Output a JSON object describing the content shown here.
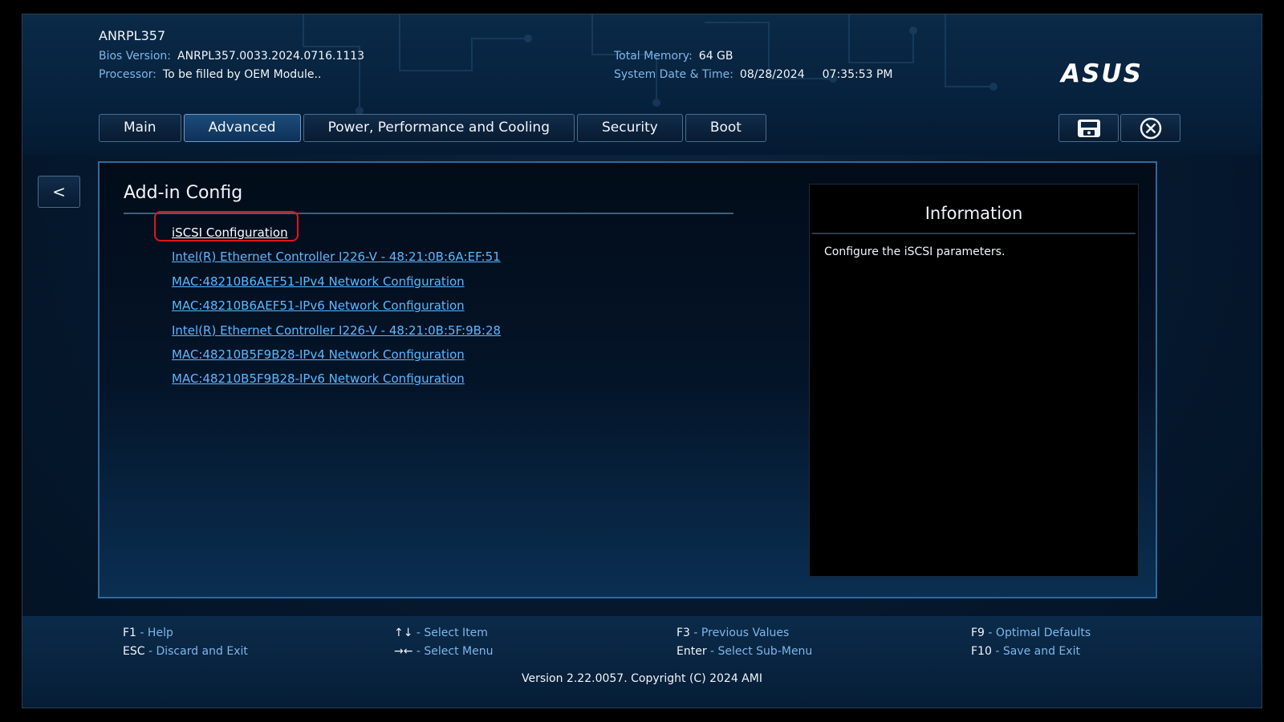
{
  "system": {
    "model": "ANRPL357",
    "bios_label": "Bios Version:",
    "bios_value": "ANRPL357.0033.2024.0716.1113",
    "processor_label": "Processor:",
    "processor_value": "To be filled by OEM Module..",
    "memory_label": "Total Memory:",
    "memory_value": "64 GB",
    "datetime_label": "System Date & Time:",
    "date_value": "08/28/2024",
    "time_value": "07:35:53 PM"
  },
  "brand": {
    "logo": "ASUS",
    "accent": "#5ab8ff",
    "highlight": "#e1151c"
  },
  "tabs": [
    {
      "label": "Main"
    },
    {
      "label": "Advanced",
      "active": true
    },
    {
      "label": "Power, Performance and Cooling"
    },
    {
      "label": "Security"
    },
    {
      "label": "Boot"
    }
  ],
  "toolbar": {
    "save_icon": "floppy-disk-icon",
    "exit_icon": "close-circle-icon"
  },
  "nav": {
    "back_label": "<"
  },
  "page": {
    "title": "Add-in Config",
    "items": [
      {
        "label": "iSCSI Configuration",
        "selected": true
      },
      {
        "label": "Intel(R) Ethernet Controller I226-V - 48:21:0B:6A:EF:51"
      },
      {
        "label": "MAC:48210B6AEF51-IPv4 Network Configuration"
      },
      {
        "label": "MAC:48210B6AEF51-IPv6 Network Configuration"
      },
      {
        "label": "Intel(R) Ethernet Controller I226-V - 48:21:0B:5F:9B:28"
      },
      {
        "label": "MAC:48210B5F9B28-IPv4 Network Configuration"
      },
      {
        "label": "MAC:48210B5F9B28-IPv6 Network Configuration"
      }
    ]
  },
  "info": {
    "title": "Information",
    "text": "Configure the iSCSI parameters."
  },
  "footer": {
    "keys": [
      {
        "key": "F1",
        "desc": "Help"
      },
      {
        "key": "ESC",
        "desc": "Discard and Exit"
      },
      {
        "key": "↑↓",
        "desc": "Select Item"
      },
      {
        "key": "→←",
        "desc": "Select Menu"
      },
      {
        "key": "F3",
        "desc": "Previous Values"
      },
      {
        "key": "Enter",
        "desc": "Select Sub-Menu"
      },
      {
        "key": "F9",
        "desc": "Optimal Defaults"
      },
      {
        "key": "F10",
        "desc": "Save and Exit"
      }
    ],
    "separator": " - ",
    "copyright": "Version 2.22.0057. Copyright (C) 2024 AMI"
  }
}
